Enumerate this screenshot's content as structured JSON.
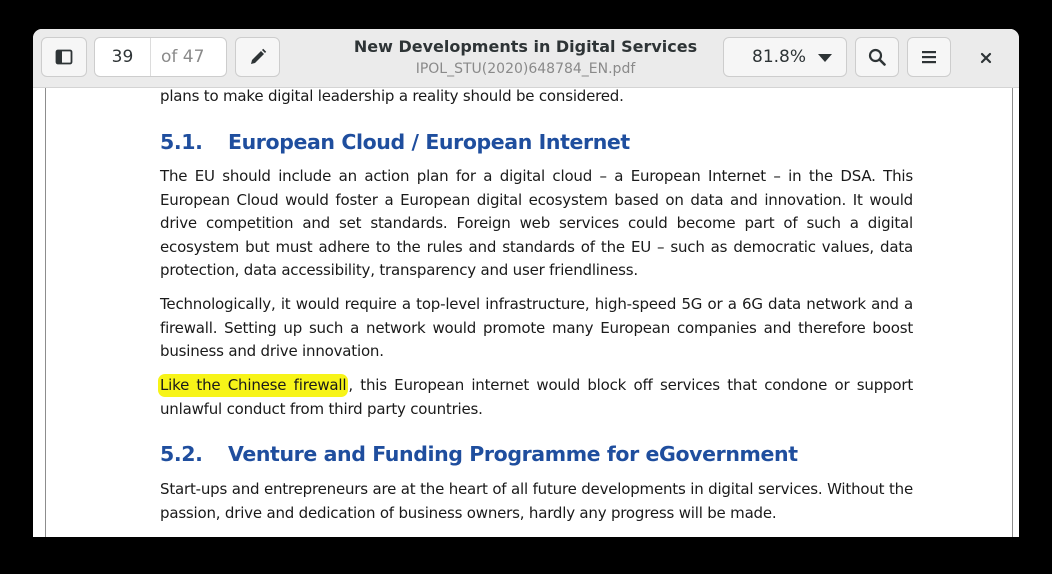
{
  "header": {
    "title": "New Developments in Digital Services",
    "subtitle": "IPOL_STU(2020)648784_EN.pdf",
    "page_number": "39",
    "page_total": "of 47",
    "zoom": "81.8%",
    "icons": [
      "sidebar-icon",
      "pencil-icon",
      "chevron-down-icon",
      "search-icon",
      "hamburger-menu-icon",
      "close-icon"
    ]
  },
  "document": {
    "intro_line": "plans to make digital leadership a reality should be considered.",
    "section1": {
      "number": "5.1.",
      "title": "European Cloud / European Internet",
      "p1": "The EU should include an action plan for a digital cloud – a European Internet – in the DSA. This European Cloud would foster a European digital ecosystem based on data and innovation. It would drive competition and set standards. Foreign web services could become part of such a digital ecosystem but must adhere to the rules and standards of the EU – such as democratic values, data protection, data accessibility, transparency and user friendliness.",
      "p2": "Technologically, it would require a top-level infrastructure, high-speed 5G or a 6G data network and a firewall. Setting up such a network would promote many European companies and therefore boost business and drive innovation.",
      "p3_highlight": "Like the Chinese firewall",
      "p3_rest": ", this European internet would block off services that condone or support unlawful conduct from third party countries."
    },
    "section2": {
      "number": "5.2.",
      "title": "Venture and Funding Programme for eGovernment",
      "p1": "Start-ups and entrepreneurs are at the heart of all future developments in digital services. Without the passion, drive and dedication of business owners, hardly any progress will be made."
    }
  },
  "colors": {
    "heading": "#1f4e9e",
    "highlight": "#f7f418",
    "headerbar": "#ebebeb"
  }
}
